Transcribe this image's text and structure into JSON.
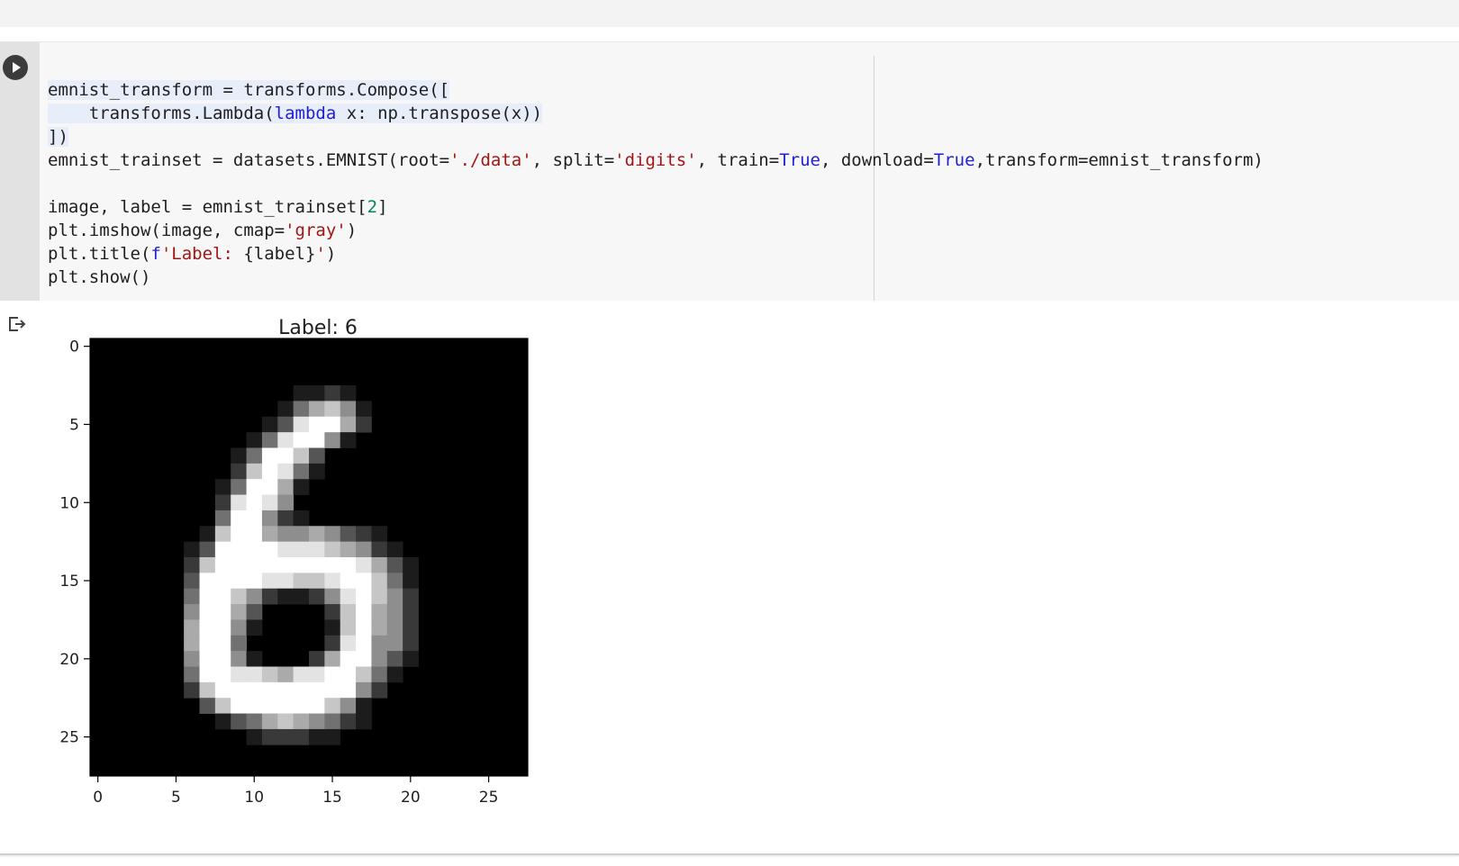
{
  "code_cell": {
    "lines": [
      [
        {
          "t": "emnist_transform = transforms.Compose([",
          "c": "",
          "hl": true
        }
      ],
      [
        {
          "t": "    transforms.Lambda(",
          "c": "",
          "hl": true
        },
        {
          "t": "lambda",
          "c": "k",
          "hl": true
        },
        {
          "t": " x: np.transpose(x))",
          "c": "",
          "hl": true
        }
      ],
      [
        {
          "t": "])",
          "c": "",
          "hl": true
        }
      ],
      [
        {
          "t": "emnist_trainset = datasets.EMNIST(root=",
          "c": ""
        },
        {
          "t": "'./data'",
          "c": "s"
        },
        {
          "t": ", split=",
          "c": ""
        },
        {
          "t": "'digits'",
          "c": "s"
        },
        {
          "t": ", train=",
          "c": ""
        },
        {
          "t": "True",
          "c": "k"
        },
        {
          "t": ", download=",
          "c": ""
        },
        {
          "t": "True",
          "c": "k"
        },
        {
          "t": ",transform=emnist_transform)",
          "c": ""
        }
      ],
      [
        {
          "t": "",
          "c": ""
        }
      ],
      [
        {
          "t": "image, label = emnist_trainset[",
          "c": ""
        },
        {
          "t": "2",
          "c": "n"
        },
        {
          "t": "]",
          "c": ""
        }
      ],
      [
        {
          "t": "plt.imshow(image, cmap=",
          "c": ""
        },
        {
          "t": "'gray'",
          "c": "s"
        },
        {
          "t": ")",
          "c": ""
        }
      ],
      [
        {
          "t": "plt.title(",
          "c": ""
        },
        {
          "t": "f",
          "c": "k"
        },
        {
          "t": "'Label: ",
          "c": "s"
        },
        {
          "t": "{label}",
          "c": ""
        },
        {
          "t": "'",
          "c": "s"
        },
        {
          "t": ")",
          "c": ""
        }
      ],
      [
        {
          "t": "plt.show()",
          "c": ""
        }
      ]
    ]
  },
  "output": {
    "icon": "output-arrow-icon",
    "run_icon": "play-icon"
  },
  "chart_data": {
    "type": "heatmap",
    "title": "Label: 6",
    "cmap": "gray",
    "xlim": [
      0,
      28
    ],
    "ylim": [
      28,
      0
    ],
    "xticks": [
      0,
      5,
      10,
      15,
      20,
      25
    ],
    "yticks": [
      0,
      5,
      10,
      15,
      20,
      25
    ],
    "pixels": [
      "0000000000000000000000000000",
      "0000000000000000000000000000",
      "0000000000000000000000000000",
      "0000000000000112100000000000",
      "0000000000001467510000000000",
      "0000000000013899620000000000",
      "0000000000148995100000000000",
      "0000000001499730000000000000",
      "0000000002798410000000000000",
      "0000000014996100000000000000",
      "0000000028985000000000000000",
      "0000000049952100000000000000",
      "0000000179965565321000000000",
      "0000001399998887652100000000",
      "0000002799999999986310000000",
      "0000003999988778997410000000",
      "0000004997521125897520000000",
      "0000005996300002796520000000",
      "0000006995100001796520000000",
      "0000006994000002895520000000",
      "0000005995100026995310000000",
      "0000004998876889974100000000",
      "0000002799999999952000000000",
      "0000000379999997510000000000",
      "0000000013467654210000000000",
      "0000000000122211000000000000",
      "0000000000000000000000000000",
      "0000000000000000000000000000"
    ]
  }
}
